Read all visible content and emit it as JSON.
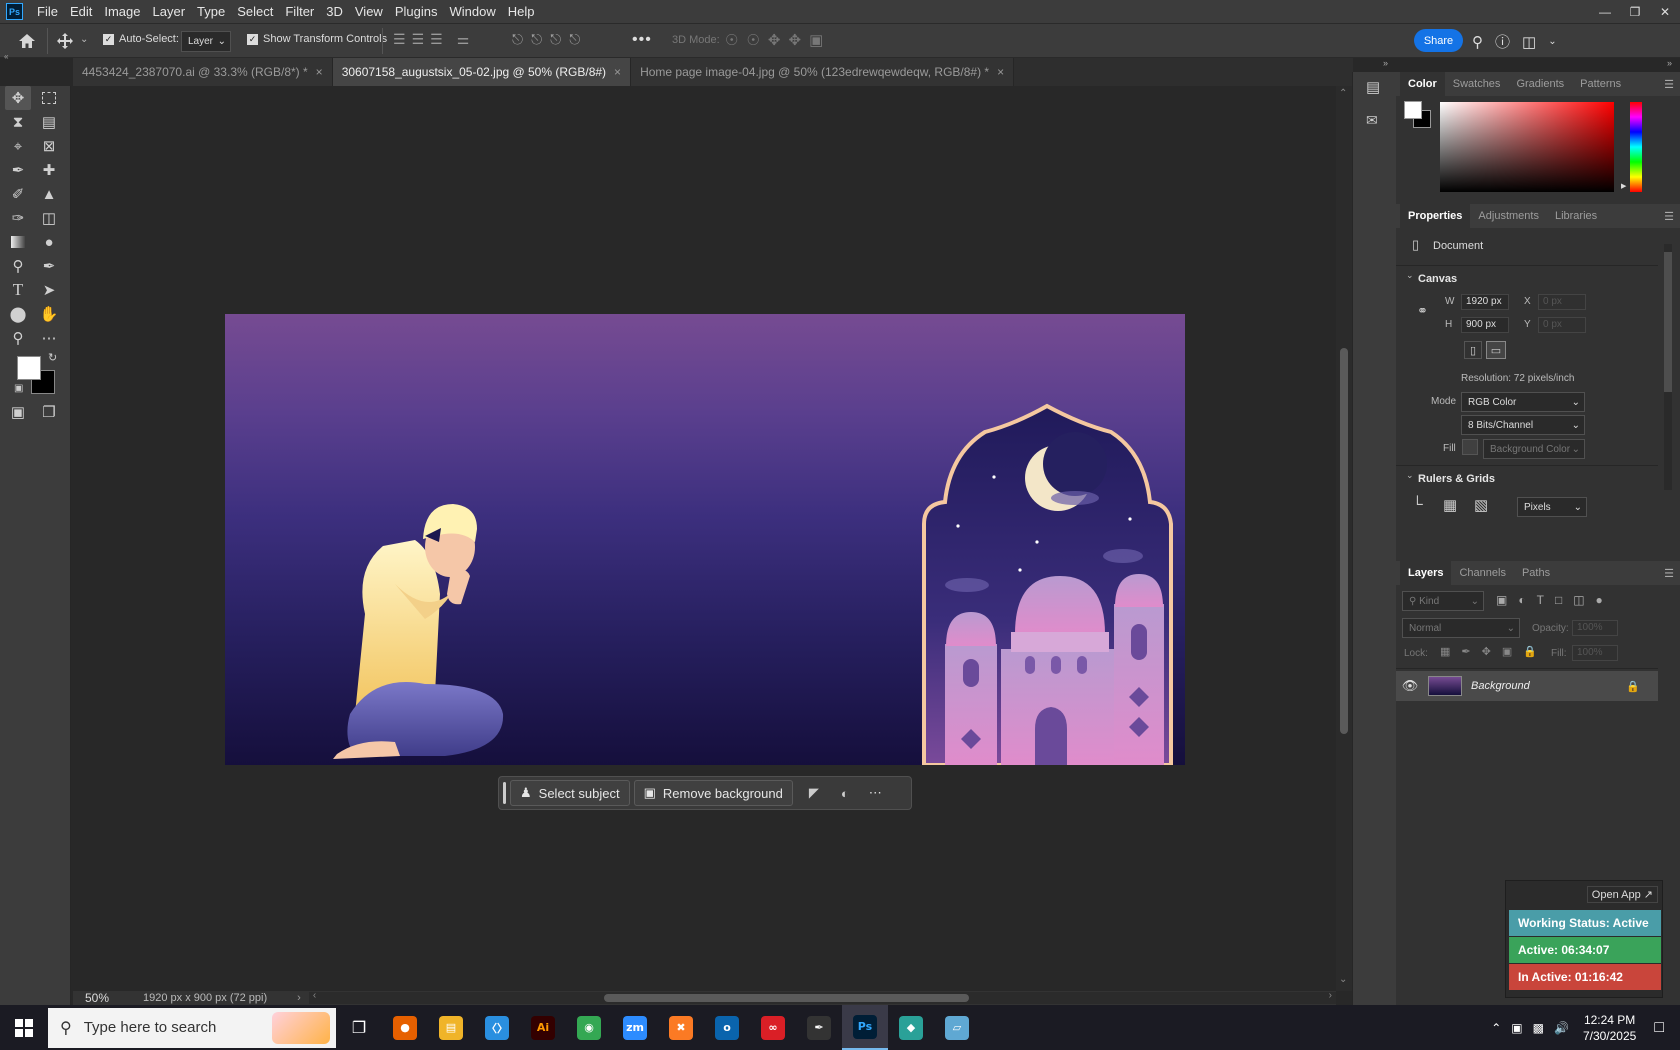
{
  "app": {
    "logo": "Ps"
  },
  "menu": [
    "File",
    "Edit",
    "Image",
    "Layer",
    "Type",
    "Select",
    "Filter",
    "3D",
    "View",
    "Plugins",
    "Window",
    "Help"
  ],
  "options": {
    "auto_select_label": "Auto-Select:",
    "auto_select_checked": true,
    "layer_select": "Layer",
    "transform_controls_label": "Show Transform Controls",
    "mode_3d_label": "3D Mode:",
    "share_label": "Share"
  },
  "tabs": [
    {
      "label": "4453424_2387070.ai @ 33.3% (RGB/8*) *",
      "active": false
    },
    {
      "label": "30607158_augustsix_05-02.jpg @ 50% (RGB/8#)",
      "active": true
    },
    {
      "label": "Home page image-04.jpg @ 50% (123edrewqewdeqw, RGB/8#) *",
      "active": false
    }
  ],
  "context_bar": {
    "select_subject": "Select subject",
    "remove_background": "Remove background"
  },
  "status": {
    "zoom": "50%",
    "doc_info": "1920 px x 900 px (72 ppi)"
  },
  "color_panel": {
    "tabs": [
      "Color",
      "Swatches",
      "Gradients",
      "Patterns"
    ],
    "foreground": "#ffffff",
    "background": "#000000",
    "hue_color": "#ff0000"
  },
  "properties": {
    "tabs": [
      "Properties",
      "Adjustments",
      "Libraries"
    ],
    "document_label": "Document",
    "canvas_title": "Canvas",
    "w_label": "W",
    "w_value": "1920 px",
    "h_label": "H",
    "h_value": "900 px",
    "x_label": "X",
    "x_placeholder": "0 px",
    "y_label": "Y",
    "y_placeholder": "0 px",
    "resolution": "Resolution: 72 pixels/inch",
    "mode_label": "Mode",
    "mode_value": "RGB Color",
    "bits_value": "8 Bits/Channel",
    "fill_label": "Fill",
    "fill_value": "Background Color",
    "rulers_title": "Rulers & Grids",
    "units_value": "Pixels"
  },
  "layers": {
    "tabs": [
      "Layers",
      "Channels",
      "Paths"
    ],
    "kind_placeholder": "Kind",
    "blend_mode": "Normal",
    "opacity_label": "Opacity:",
    "opacity_value": "100%",
    "lock_label": "Lock:",
    "fill_label": "Fill:",
    "fill_value": "100%",
    "items": [
      {
        "name": "Background",
        "visible": true,
        "locked": true
      }
    ]
  },
  "widget": {
    "open_app": "Open App ↗",
    "status": "Working Status: Active",
    "active": "Active: 06:34:07",
    "inactive": "In Active: 01:16:42",
    "colors": {
      "status": "#4a9da8",
      "active": "#3aa35a",
      "inactive": "#c9453b"
    }
  },
  "taskbar": {
    "search_placeholder": "Type here to search",
    "time": "12:24 PM",
    "date": "7/30/2025",
    "apps": [
      {
        "name": "firefox",
        "glyph": "●",
        "color": "#e66000"
      },
      {
        "name": "file-explorer",
        "glyph": "▤",
        "color": "#f0b429"
      },
      {
        "name": "vscode",
        "glyph": "〈〉",
        "color": "#2a8fe0"
      },
      {
        "name": "illustrator",
        "glyph": "Ai",
        "color": "#330000"
      },
      {
        "name": "chrome",
        "glyph": "◉",
        "color": "#34a853"
      },
      {
        "name": "zoom",
        "glyph": "zm",
        "color": "#2d8cff"
      },
      {
        "name": "xampp",
        "glyph": "✖",
        "color": "#fb7a24"
      },
      {
        "name": "outlook",
        "glyph": "o",
        "color": "#0a64ad"
      },
      {
        "name": "creative-cloud",
        "glyph": "∞",
        "color": "#da1f26"
      },
      {
        "name": "pen-tool",
        "glyph": "✒",
        "color": "#333333"
      },
      {
        "name": "photoshop",
        "glyph": "Ps",
        "color": "#001e36"
      },
      {
        "name": "app-diamond",
        "glyph": "◆",
        "color": "#2aa198"
      },
      {
        "name": "app-note",
        "glyph": "▱",
        "color": "#5fa8d3"
      }
    ]
  }
}
